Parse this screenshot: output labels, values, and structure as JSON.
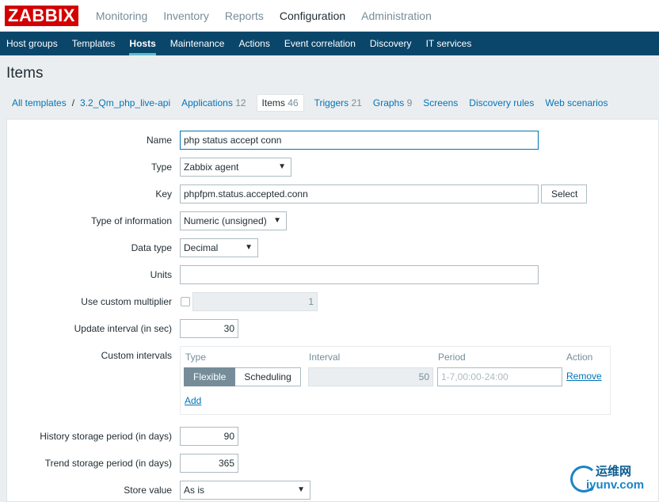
{
  "brand": {
    "logo": "ZABBIX"
  },
  "top_nav": [
    "Monitoring",
    "Inventory",
    "Reports",
    "Configuration",
    "Administration"
  ],
  "sub_nav": [
    "Host groups",
    "Templates",
    "Hosts",
    "Maintenance",
    "Actions",
    "Event correlation",
    "Discovery",
    "IT services"
  ],
  "page": {
    "title": "Items"
  },
  "breadcrumb": {
    "all_templates": "All templates",
    "sep": "/",
    "template": "3.2_Qm_php_live-api",
    "applications": "Applications",
    "applications_count": "12",
    "items": "Items",
    "items_count": "46",
    "triggers": "Triggers",
    "triggers_count": "21",
    "graphs": "Graphs",
    "graphs_count": "9",
    "screens": "Screens",
    "discovery_rules": "Discovery rules",
    "web_scenarios": "Web scenarios"
  },
  "form": {
    "name_label": "Name",
    "name_value": "php status accept conn",
    "type_label": "Type",
    "type_value": "Zabbix agent",
    "key_label": "Key",
    "key_value": "phpfpm.status.accepted.conn",
    "select_button": "Select",
    "info_type_label": "Type of information",
    "info_type_value": "Numeric (unsigned)",
    "data_type_label": "Data type",
    "data_type_value": "Decimal",
    "units_label": "Units",
    "units_value": "",
    "multiplier_label": "Use custom multiplier",
    "multiplier_value": "1",
    "update_label": "Update interval (in sec)",
    "update_value": "30",
    "custom_intervals_label": "Custom intervals",
    "ci_headers": {
      "type": "Type",
      "interval": "Interval",
      "period": "Period",
      "action": "Action"
    },
    "ci_flexible": "Flexible",
    "ci_scheduling": "Scheduling",
    "ci_interval_value": "50",
    "ci_period_placeholder": "1-7,00:00-24:00",
    "ci_remove": "Remove",
    "ci_add": "Add",
    "history_label": "History storage period (in days)",
    "history_value": "90",
    "trend_label": "Trend storage period (in days)",
    "trend_value": "365",
    "store_label": "Store value",
    "store_value": "As is"
  },
  "watermark": {
    "cn": "运维网",
    "en": "iyunv.com"
  },
  "colors": {
    "brand_red": "#d40000",
    "nav_blue": "#0a466a",
    "link_blue": "#0275b8",
    "active_toggle": "#768d99"
  }
}
